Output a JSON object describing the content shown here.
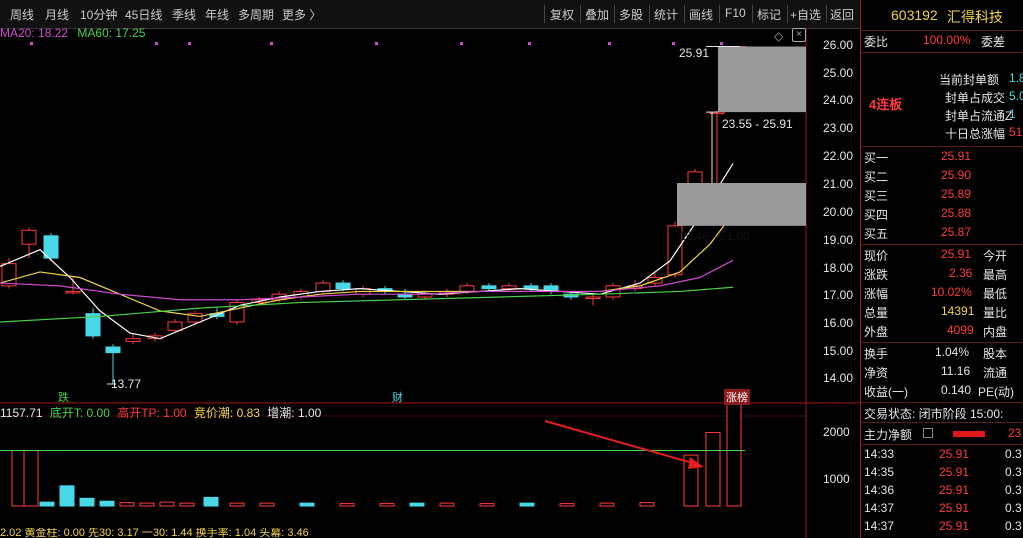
{
  "topbar": {
    "periods": [
      "周线",
      "月线",
      "10分钟",
      "45日线",
      "季线",
      "年线",
      "多周期",
      "更多 〉"
    ],
    "tools": [
      "复权",
      "叠加",
      "多股",
      "统计",
      "画线",
      "F10",
      "标记",
      "+自选",
      "返回"
    ]
  },
  "ma_legend": {
    "ma20": "MA20: 18.22",
    "ma60": "MA60: 17.25"
  },
  "price_axis": [
    "26.00",
    "25.00",
    "24.00",
    "23.00",
    "22.00",
    "21.00",
    "20.00",
    "19.00",
    "18.00",
    "17.00",
    "16.00",
    "15.00",
    "14.00"
  ],
  "volume_axis": [
    "2000",
    "1000"
  ],
  "annotations": {
    "high_label": "25.91",
    "band_upper": "23.55 - 25.91",
    "band_lower": "19.46 - 21.00",
    "low_label": "13.77",
    "event_left": "跌",
    "event_mid": "财",
    "event_right": "涨榜"
  },
  "indicator_legend": {
    "value": "1157.71",
    "kaiT": "底开T: 0.00",
    "gaoT": "高开TP: 1.00",
    "jingjia": "竞价潮: 0.83",
    "zengchao": "增潮: 1.00"
  },
  "bottom_legend": "2.02  黄金柱: 0.00  先30: 3.17  一30: 1.44  换手率: 1.04  头幕: 3.46",
  "stock": {
    "code": "603192",
    "name": "汇得科技"
  },
  "weibi": {
    "label": "委比",
    "value": "100.00%",
    "label2": "委差"
  },
  "board": {
    "tag": "4连板",
    "rows": [
      {
        "label": "当前封单额",
        "value": "1.8"
      },
      {
        "label": "封单占成交",
        "value": "5.0"
      },
      {
        "label": "封单占流通Z",
        "value": "1"
      },
      {
        "label": "十日总涨幅",
        "value": "51"
      }
    ]
  },
  "bids": [
    {
      "label": "买一",
      "price": "25.91"
    },
    {
      "label": "买二",
      "price": "25.90"
    },
    {
      "label": "买三",
      "price": "25.89"
    },
    {
      "label": "买四",
      "price": "25.88"
    },
    {
      "label": "买五",
      "price": "25.87"
    }
  ],
  "quote": [
    {
      "l1": "现价",
      "v1": "25.91",
      "l2": "今开"
    },
    {
      "l1": "涨跌",
      "v1": "2.36",
      "l2": "最高"
    },
    {
      "l1": "涨幅",
      "v1": "10.02%",
      "l2": "最低"
    },
    {
      "l1": "总量",
      "v1": "14391",
      "l2": "量比"
    },
    {
      "l1": "外盘",
      "v1": "4099",
      "l2": "内盘"
    }
  ],
  "stats": [
    {
      "l1": "换手",
      "v1": "1.04%",
      "l2": "股本"
    },
    {
      "l1": "净资",
      "v1": "11.16",
      "l2": "流通"
    },
    {
      "l1": "收益(一)",
      "v1": "0.140",
      "l2": "PE(动)"
    }
  ],
  "status": "交易状态: 闭市阶段 15:00:",
  "main_flow": {
    "label": "主力净额",
    "value": "23"
  },
  "ticks": [
    {
      "time": "14:33",
      "price": "25.91",
      "vol": "0.3"
    },
    {
      "time": "14:35",
      "price": "25.91",
      "vol": "0.3"
    },
    {
      "time": "14:36",
      "price": "25.91",
      "vol": "0.3"
    },
    {
      "time": "14:37",
      "price": "25.91",
      "vol": "0.3"
    },
    {
      "time": "14:37",
      "price": "25.91",
      "vol": "0.3"
    }
  ],
  "colors": {
    "up": "#ff3b3b",
    "down": "#49d8e8",
    "ma5": "#ffffff",
    "ma10": "#f2d34a",
    "ma20": "#d04ad0",
    "ma60": "#4ad04a"
  }
}
